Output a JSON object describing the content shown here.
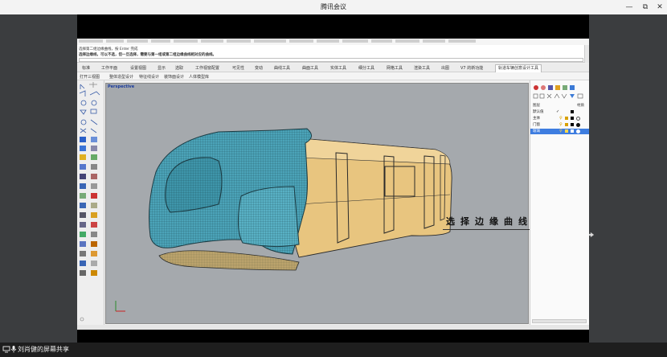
{
  "window": {
    "title": "腾讯会议",
    "controls": {
      "minimize": "—",
      "restore": "⧉",
      "close": "✕"
    }
  },
  "bottom_bar": {
    "presenter_label": "刘肖健的屏幕共享"
  },
  "rhino": {
    "command_lines": [
      "选择第二组边缘曲线，按 Enter 完成",
      "选择边缘线，可以不选，但一旦选择，需要与第一组或第二组边缘曲线相对应的曲线。"
    ],
    "tabs": [
      "标准",
      "工作平面",
      "设置视图",
      "显示",
      "选取",
      "工作视窗配置",
      "可见性",
      "变动",
      "曲线工具",
      "曲面工具",
      "实体工具",
      "细分工具",
      "网格工具",
      "渲染工具",
      "出图",
      "V7 的新功能",
      "轨道车辆创意设计工具"
    ],
    "subtools": [
      "打开三视图",
      "整体造型设计",
      "特征线设计",
      "装饰面设计",
      "人体模型库"
    ],
    "viewport_label": "Perspective",
    "caption": "选择边缘曲线",
    "layers": {
      "header_name": "图层",
      "header_material": "材质",
      "rows": [
        "默认值",
        "主体",
        "门窗",
        "玻璃"
      ],
      "selected_index": 3
    }
  },
  "colors": {
    "surface_teal": "#4ba3b8",
    "surface_gold": "#e8c57f",
    "viewport_bg": "#a5a9ad",
    "selection_blue": "#3e7de0"
  }
}
